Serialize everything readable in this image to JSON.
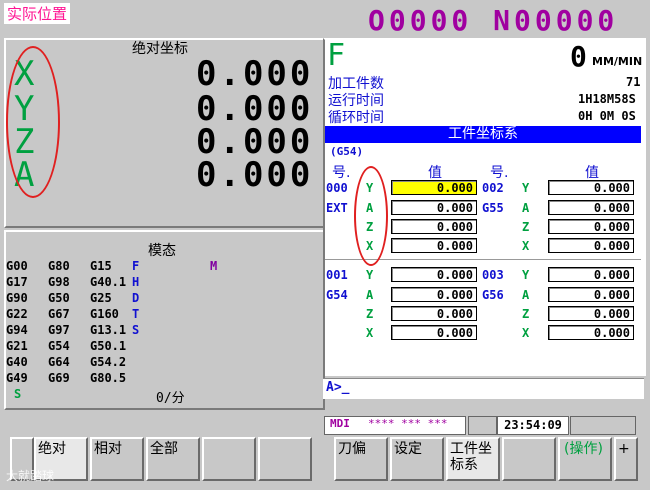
{
  "header": {
    "title": "实际位置",
    "program": "O0000 N00000"
  },
  "abs_panel": {
    "title": "绝对坐标",
    "axes": [
      {
        "axis": "X",
        "value": "0.000"
      },
      {
        "axis": "Y",
        "value": "0.000"
      },
      {
        "axis": "Z",
        "value": "0.000"
      },
      {
        "axis": "A",
        "value": "0.000"
      }
    ]
  },
  "feed": {
    "letter": "F",
    "value": "0",
    "unit": "MM/MIN"
  },
  "info": {
    "parts_label": "加工件数",
    "parts_value": "71",
    "run_label": "运行时间",
    "run_value": "1H18M58S",
    "cycle_label": "循环时间",
    "cycle_value": "0H 0M 0S"
  },
  "work_coord": {
    "title": "工件坐标系",
    "group": "(G54)",
    "no_header": "号.",
    "val_header": "值",
    "left": [
      {
        "no1": "000",
        "no2": "EXT",
        "rows": [
          [
            "Y",
            "0.000"
          ],
          [
            "A",
            "0.000"
          ],
          [
            "Z",
            "0.000"
          ],
          [
            "X",
            "0.000"
          ]
        ]
      },
      {
        "no1": "001",
        "no2": "G54",
        "rows": [
          [
            "Y",
            "0.000"
          ],
          [
            "A",
            "0.000"
          ],
          [
            "Z",
            "0.000"
          ],
          [
            "X",
            "0.000"
          ]
        ]
      }
    ],
    "right": [
      {
        "no1": "002",
        "no2": "G55",
        "rows": [
          [
            "Y",
            "0.000"
          ],
          [
            "A",
            "0.000"
          ],
          [
            "Z",
            "0.000"
          ],
          [
            "X",
            "0.000"
          ]
        ]
      },
      {
        "no1": "003",
        "no2": "G56",
        "rows": [
          [
            "Y",
            "0.000"
          ],
          [
            "A",
            "0.000"
          ],
          [
            "Z",
            "0.000"
          ],
          [
            "X",
            "0.000"
          ]
        ]
      }
    ]
  },
  "modal": {
    "title": "模态",
    "rows": [
      [
        "G00",
        "G80",
        "G15",
        "F",
        "",
        "M"
      ],
      [
        "G17",
        "G98",
        "G40.1",
        "H",
        "",
        ""
      ],
      [
        "G90",
        "G50",
        "G25",
        "D",
        "",
        ""
      ],
      [
        "G22",
        "G67",
        "G160",
        "T",
        "",
        ""
      ],
      [
        "G94",
        "G97",
        "G13.1",
        "S",
        "",
        ""
      ],
      [
        "G21",
        "G54",
        "G50.1",
        "",
        "",
        ""
      ],
      [
        "G40",
        "G64",
        "G54.2",
        "",
        "",
        ""
      ],
      [
        "G49",
        "G69",
        "G80.5",
        "",
        "",
        ""
      ]
    ],
    "s_label": "S",
    "rate": "0/分"
  },
  "input": {
    "prompt": "A>_"
  },
  "status": {
    "mode": "MDI",
    "stars": "**** *** ***",
    "time": "23:54:09"
  },
  "softkeys": {
    "k1": "绝对",
    "k2": "相对",
    "k3": "全部",
    "k4": "",
    "k5": "",
    "k6": "刀偏",
    "k7": "设定",
    "k8a": "工件坐",
    "k8b": "标系",
    "k9": "",
    "k10": "(操作)",
    "k11": "+"
  },
  "watermark": "大就踏球",
  "colors": {
    "axis_green": "#00a040",
    "highlight_blue": "#0000ff",
    "mode_purple": "#a000a0",
    "annotation_red": "#e02020"
  }
}
